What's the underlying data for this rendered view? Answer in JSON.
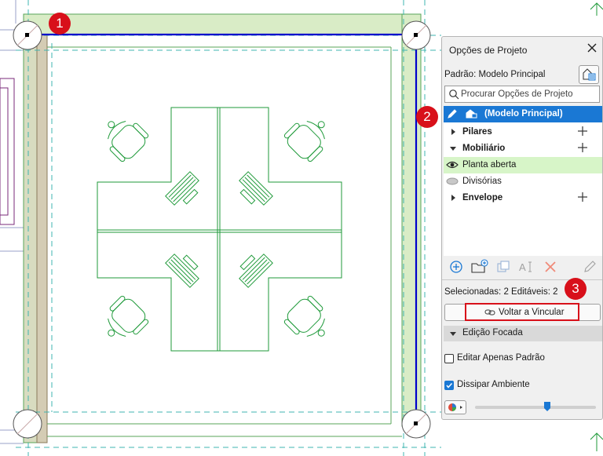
{
  "panel": {
    "title": "Opções de Projeto",
    "default_label": "Padrão: Modelo Principal",
    "search_placeholder": "Procurar Opções de Projeto",
    "items": [
      {
        "label": "(Modelo Principal)"
      },
      {
        "label": "Pilares"
      },
      {
        "label": "Mobiliário"
      },
      {
        "label": "Planta aberta"
      },
      {
        "label": "Divisórias"
      },
      {
        "label": "Envelope"
      }
    ],
    "selection_info": "Selecionadas: 2 Editáveis: 2",
    "relink_label": "Voltar a Vincular",
    "focus_section": "Edição Focada",
    "edit_default_only": "Editar Apenas Padrão",
    "edit_default_only_checked": false,
    "dim_environment": "Dissipar Ambiente",
    "dim_environment_checked": true,
    "dim_level": 0.6
  },
  "markers": [
    "1",
    "2",
    "3"
  ],
  "colors": {
    "accent": "#1a78d4",
    "marker": "#d8101a",
    "furniture": "#1f9a3a",
    "wall_fill": "#d9ecc6",
    "selection": "#0000cc"
  }
}
